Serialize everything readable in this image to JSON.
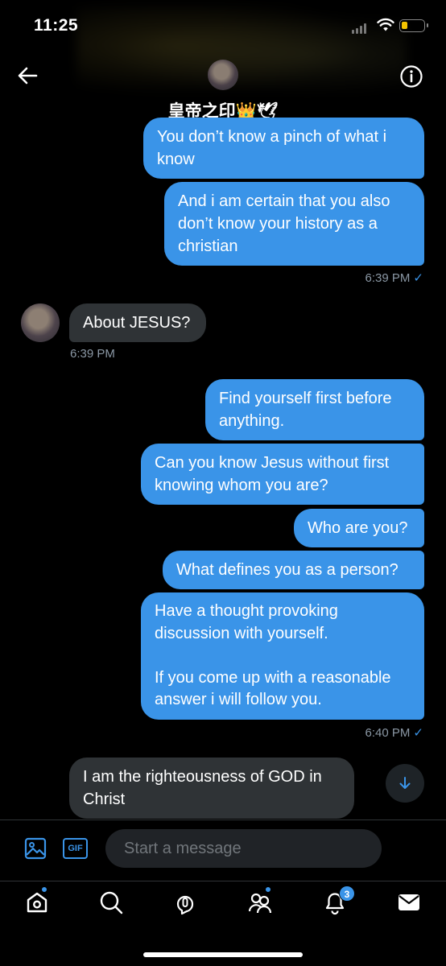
{
  "status_bar": {
    "time": "11:25"
  },
  "header": {
    "name": "皇帝之印👑🕊",
    "back_icon": "back-arrow-icon",
    "info_icon": "info-icon"
  },
  "messages": [
    {
      "side": "out",
      "text": "You don’t know a pinch of what i\nknow"
    },
    {
      "side": "out",
      "text": "And i am certain that you also\ndon’t know your history as a\nchristian"
    },
    {
      "side": "out_time",
      "text": "6:39 PM"
    },
    {
      "side": "in",
      "text": "About JESUS?"
    },
    {
      "side": "in_time",
      "text": "6:39 PM"
    },
    {
      "side": "out",
      "text": "Find yourself first before\nanything."
    },
    {
      "side": "out",
      "text": "Can you know Jesus without first\nknowing whom you are?"
    },
    {
      "side": "out",
      "text": "Who are you?"
    },
    {
      "side": "out",
      "text": "What defines you as a person?"
    },
    {
      "side": "out",
      "text": "Have a thought provoking\ndiscussion with yourself.\n\nIf you come up with a reasonable\nanswer i will follow you."
    },
    {
      "side": "out_time",
      "text": "6:40 PM"
    },
    {
      "side": "in",
      "text": "I am the righteousness of GOD in\nChrist"
    }
  ],
  "read_check": "✓",
  "composer": {
    "placeholder": "Start a message",
    "gif_label": "GIF"
  },
  "tabbar": {
    "notifications_badge": "3",
    "items": [
      "home-icon",
      "search-icon",
      "spaces-icon",
      "communities-icon",
      "notifications-icon",
      "messages-icon"
    ]
  },
  "colors": {
    "accent": "#3a94e8",
    "incoming_bubble": "#2f3336",
    "background": "#000000"
  }
}
